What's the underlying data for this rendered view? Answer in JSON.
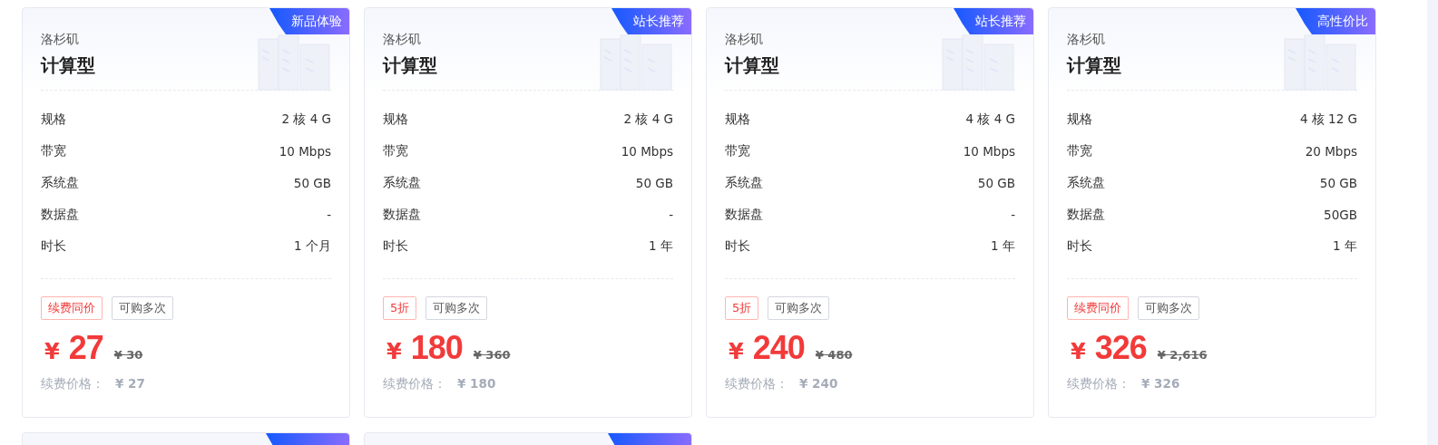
{
  "cards": [
    {
      "badge": "新品体验",
      "region": "洛杉矶",
      "type": "计算型",
      "specs": [
        {
          "label": "规格",
          "value": "2 核 4 G"
        },
        {
          "label": "带宽",
          "value": "10 Mbps"
        },
        {
          "label": "系统盘",
          "value": "50 GB"
        },
        {
          "label": "数据盘",
          "value": "-"
        },
        {
          "label": "时长",
          "value": "1 个月"
        }
      ],
      "tags": [
        {
          "kind": "promo",
          "text": "续费同价"
        },
        {
          "kind": "plain",
          "text": "可购多次"
        }
      ],
      "currency": "¥",
      "price": "27",
      "original_price": "¥ 30",
      "renewal_label": "续费价格：",
      "renewal_price": "¥ 27"
    },
    {
      "badge": "站长推荐",
      "region": "洛杉矶",
      "type": "计算型",
      "specs": [
        {
          "label": "规格",
          "value": "2 核 4 G"
        },
        {
          "label": "带宽",
          "value": "10 Mbps"
        },
        {
          "label": "系统盘",
          "value": "50 GB"
        },
        {
          "label": "数据盘",
          "value": "-"
        },
        {
          "label": "时长",
          "value": "1 年"
        }
      ],
      "tags": [
        {
          "kind": "promo",
          "text": "5折"
        },
        {
          "kind": "plain",
          "text": "可购多次"
        }
      ],
      "currency": "¥",
      "price": "180",
      "original_price": "¥ 360",
      "renewal_label": "续费价格：",
      "renewal_price": "¥ 180"
    },
    {
      "badge": "站长推荐",
      "region": "洛杉矶",
      "type": "计算型",
      "specs": [
        {
          "label": "规格",
          "value": "4 核 4 G"
        },
        {
          "label": "带宽",
          "value": "10 Mbps"
        },
        {
          "label": "系统盘",
          "value": "50 GB"
        },
        {
          "label": "数据盘",
          "value": "-"
        },
        {
          "label": "时长",
          "value": "1 年"
        }
      ],
      "tags": [
        {
          "kind": "promo",
          "text": "5折"
        },
        {
          "kind": "plain",
          "text": "可购多次"
        }
      ],
      "currency": "¥",
      "price": "240",
      "original_price": "¥ 480",
      "renewal_label": "续费价格：",
      "renewal_price": "¥ 240"
    },
    {
      "badge": "高性价比",
      "region": "洛杉矶",
      "type": "计算型",
      "specs": [
        {
          "label": "规格",
          "value": "4 核 12 G"
        },
        {
          "label": "带宽",
          "value": "20 Mbps"
        },
        {
          "label": "系统盘",
          "value": "50 GB"
        },
        {
          "label": "数据盘",
          "value": "50GB"
        },
        {
          "label": "时长",
          "value": "1 年"
        }
      ],
      "tags": [
        {
          "kind": "promo",
          "text": "续费同价"
        },
        {
          "kind": "plain",
          "text": "可购多次"
        }
      ],
      "currency": "¥",
      "price": "326",
      "original_price": "¥ 2,616",
      "renewal_label": "续费价格：",
      "renewal_price": "¥ 326"
    }
  ],
  "lower_row": [
    {
      "kind": "card"
    },
    {
      "kind": "card"
    }
  ]
}
